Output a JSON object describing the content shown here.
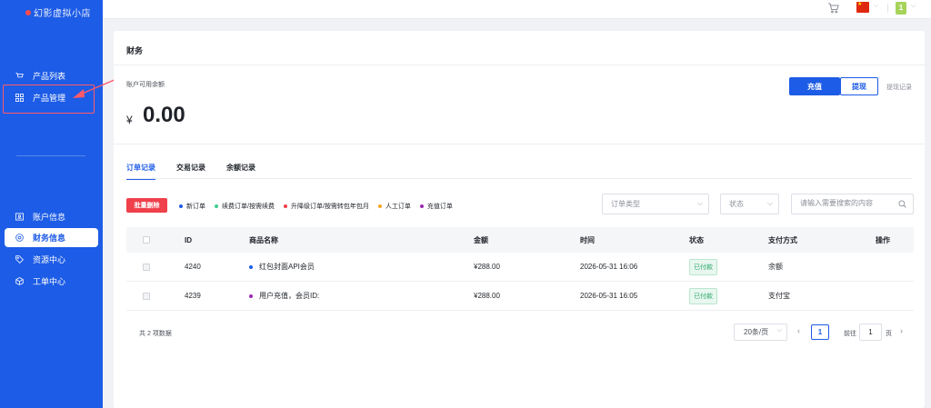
{
  "sidebar": {
    "logo": "幻影虚拟小店",
    "items": [
      {
        "label": "产品列表",
        "icon": "cart-icon"
      },
      {
        "label": "产品管理",
        "icon": "grid-icon"
      },
      {
        "label": "账户信息",
        "icon": "id-card-icon"
      },
      {
        "label": "财务信息",
        "icon": "finance-icon"
      },
      {
        "label": "资源中心",
        "icon": "tag-icon"
      },
      {
        "label": "工单中心",
        "icon": "box-icon"
      }
    ],
    "active_index": 3
  },
  "topbar": {
    "avatar_text": "1",
    "language_flag": "cn-flag-icon"
  },
  "page": {
    "title": "财务",
    "balance_label": "账户可用余额",
    "currency": "¥",
    "balance": "0.00",
    "recharge_label": "充值",
    "withdraw_label": "提现",
    "withdraw_record_label": "提现记录"
  },
  "tabs": [
    {
      "label": "订单记录",
      "active": true
    },
    {
      "label": "交易记录",
      "active": false
    },
    {
      "label": "余额记录",
      "active": false
    }
  ],
  "toolbar": {
    "batch_delete_label": "批量删除",
    "legend": [
      {
        "label": "新订单",
        "color": "#1d5ce6"
      },
      {
        "label": "续费订单/按需续费",
        "color": "#3ccf8e"
      },
      {
        "label": "升降级订单/按需转包年包月",
        "color": "#f0404b"
      },
      {
        "label": "人工订单",
        "color": "#f5a623"
      },
      {
        "label": "充值订单",
        "color": "#9c27b0"
      }
    ],
    "order_type_placeholder": "订单类型",
    "status_placeholder": "状态",
    "search_placeholder": "请输入需要搜索的内容"
  },
  "table": {
    "columns": [
      "ID",
      "商品名称",
      "金额",
      "时间",
      "状态",
      "支付方式",
      "操作"
    ],
    "rows": [
      {
        "id": "4240",
        "name": "红包封面API会员",
        "dot_color": "#1d5ce6",
        "amount": "¥288.00",
        "time": "2026-05-31 16:06",
        "status": "已付款",
        "payment": "余额"
      },
      {
        "id": "4239",
        "name": "用户充值，会员ID:",
        "dot_color": "#9c27b0",
        "amount": "¥288.00",
        "time": "2026-05-31 16:05",
        "status": "已付款",
        "payment": "支付宝"
      }
    ]
  },
  "pagination": {
    "total_label": "共 2 项数据",
    "page_size": "20条/页",
    "current_page": "1",
    "goto_label": "前往",
    "goto_value": "1",
    "page_unit": "页"
  }
}
